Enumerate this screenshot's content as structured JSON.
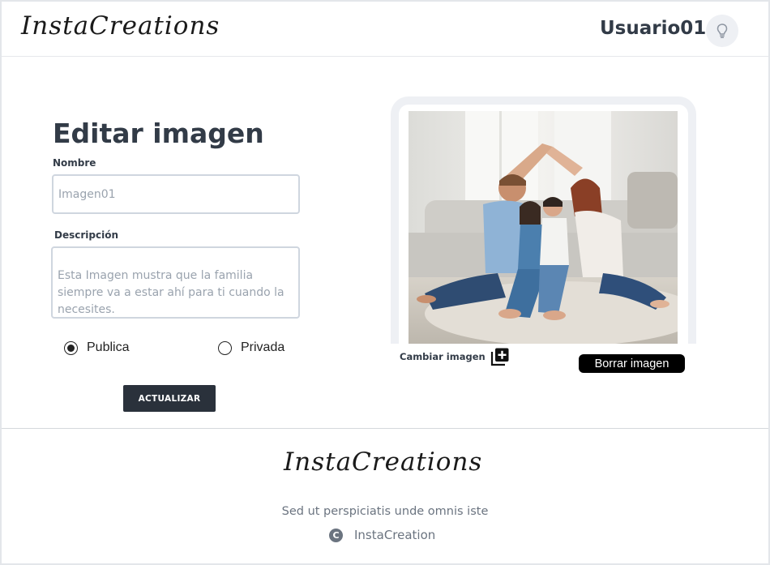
{
  "header": {
    "logo": "InstaCreations",
    "username": "Usuario01",
    "avatar_icon": "lightbulb-icon"
  },
  "form": {
    "title": "Editar imagen",
    "name_label": "Nombre",
    "name_placeholder": "Imagen01",
    "description_label": "Descripción",
    "description_text": "Esta Imagen mustra que la familia siempre va a estar ahí para ti cuando la necesites.",
    "visibility": {
      "options": [
        "Publica",
        "Privada"
      ],
      "selected": "Publica"
    },
    "submit_label": "ACTUALIZAR"
  },
  "image_panel": {
    "change_label": "Cambiar imagen",
    "change_icon": "add-image-icon",
    "delete_label": "Borrar imagen"
  },
  "footer": {
    "logo": "InstaCreations",
    "tagline": "Sed ut perspiciatis unde omnis iste",
    "copyright_icon": "copyright-icon",
    "copyright_text": "InstaCreation"
  },
  "colors": {
    "primary_dark": "#2a313b",
    "text": "#323b47",
    "input_border": "#cfd6df",
    "frame": "#eef0f4",
    "muted": "#6b7480"
  }
}
